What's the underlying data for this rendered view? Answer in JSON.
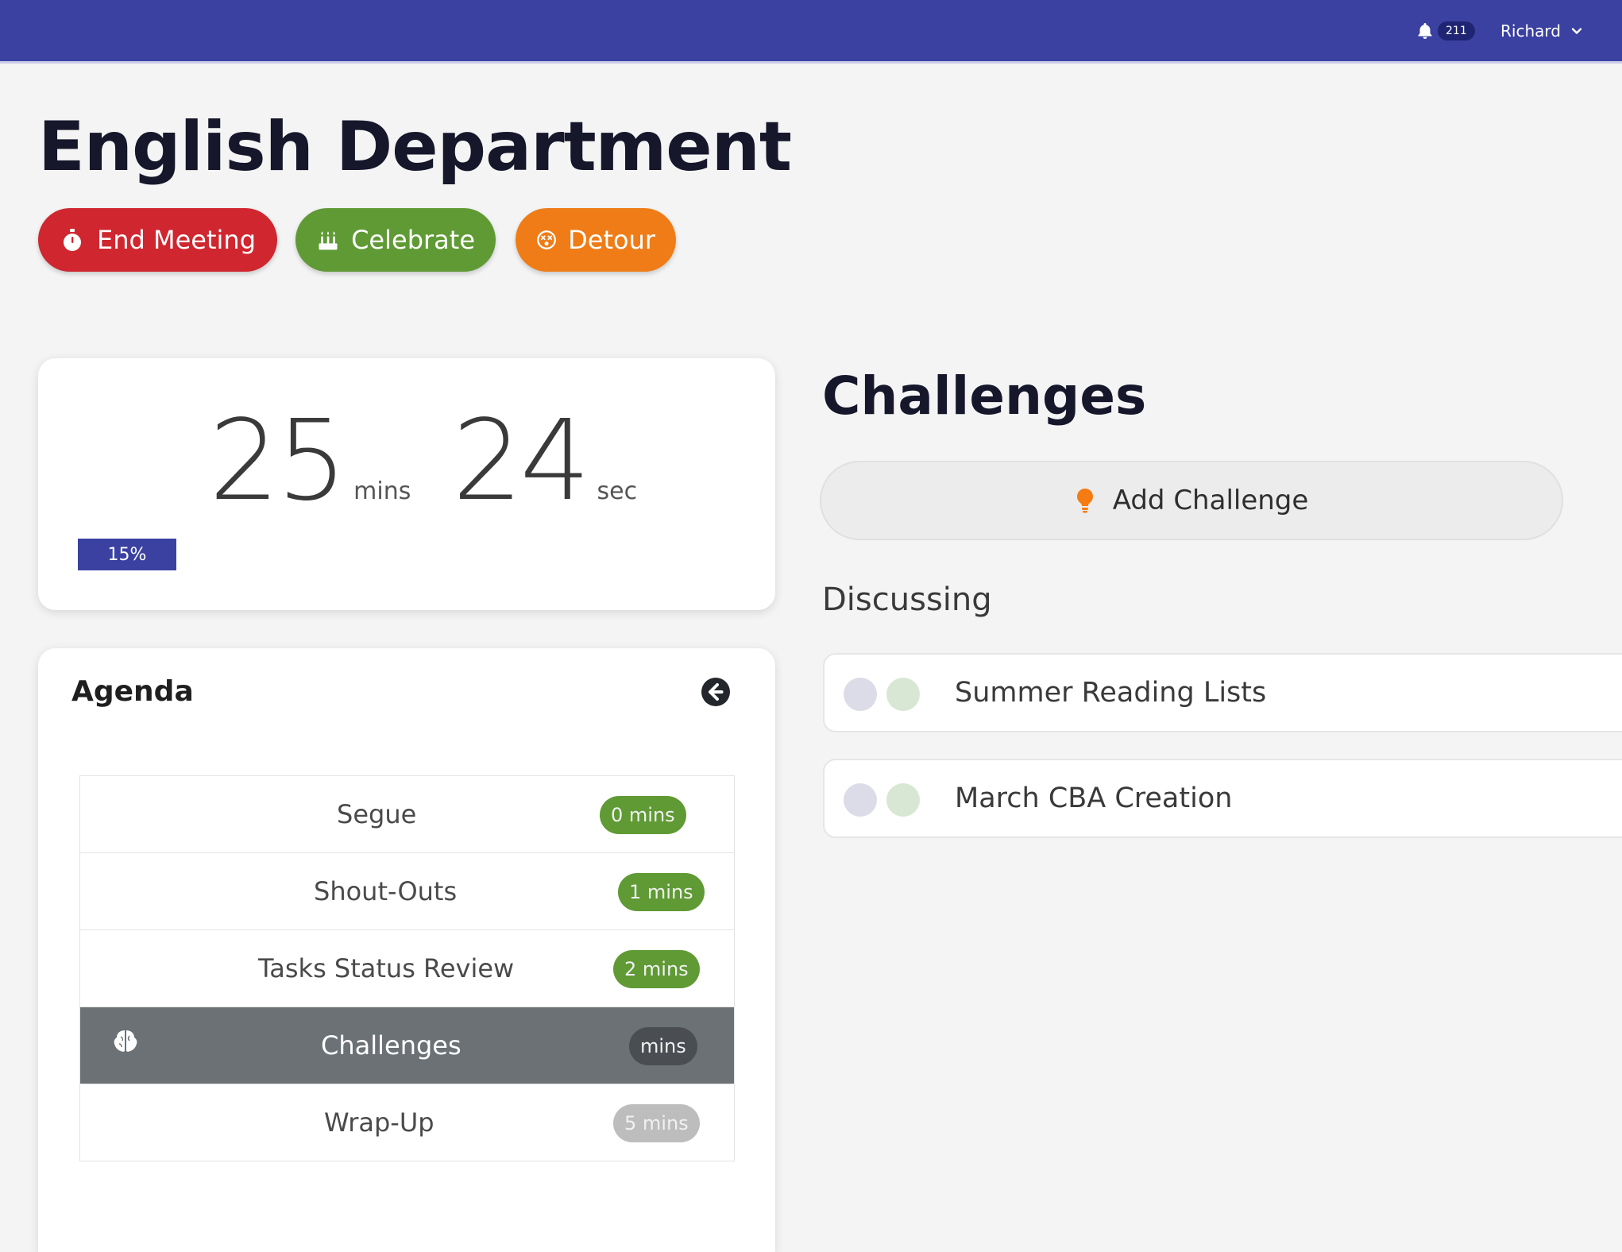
{
  "header": {
    "notification_count": "211",
    "user_name": "Richard",
    "background_color": "#3a41a1"
  },
  "page": {
    "title": "English Department"
  },
  "actions": {
    "end_meeting": "End Meeting",
    "celebrate": "Celebrate",
    "detour": "Detour",
    "colors": {
      "end_meeting": "#d0262f",
      "celebrate": "#5f9a34",
      "detour": "#ef7c16"
    }
  },
  "timer": {
    "minutes": "25",
    "minutes_unit": "mins",
    "seconds": "24",
    "seconds_unit": "sec",
    "progress_label": "15%",
    "progress_value": 0.15
  },
  "agenda": {
    "title": "Agenda",
    "items": [
      {
        "label": "Segue",
        "duration": "0 mins",
        "badge_color": "#5f9a34",
        "active": false
      },
      {
        "label": "Shout-Outs",
        "duration": "1 mins",
        "badge_color": "#5f9a34",
        "active": false
      },
      {
        "label": "Tasks Status Review",
        "duration": "2 mins",
        "badge_color": "#5f9a34",
        "active": false
      },
      {
        "label": "Challenges",
        "duration": "mins",
        "badge_color": "#4a4e52",
        "active": true
      },
      {
        "label": "Wrap-Up",
        "duration": "5 mins",
        "badge_color": "#bdbdbd",
        "active": false
      }
    ]
  },
  "challenges": {
    "title": "Challenges",
    "add_label": "Add Challenge",
    "discussing_label": "Discussing",
    "items": [
      {
        "label": "Summer Reading Lists"
      },
      {
        "label": "March CBA Creation"
      }
    ]
  }
}
